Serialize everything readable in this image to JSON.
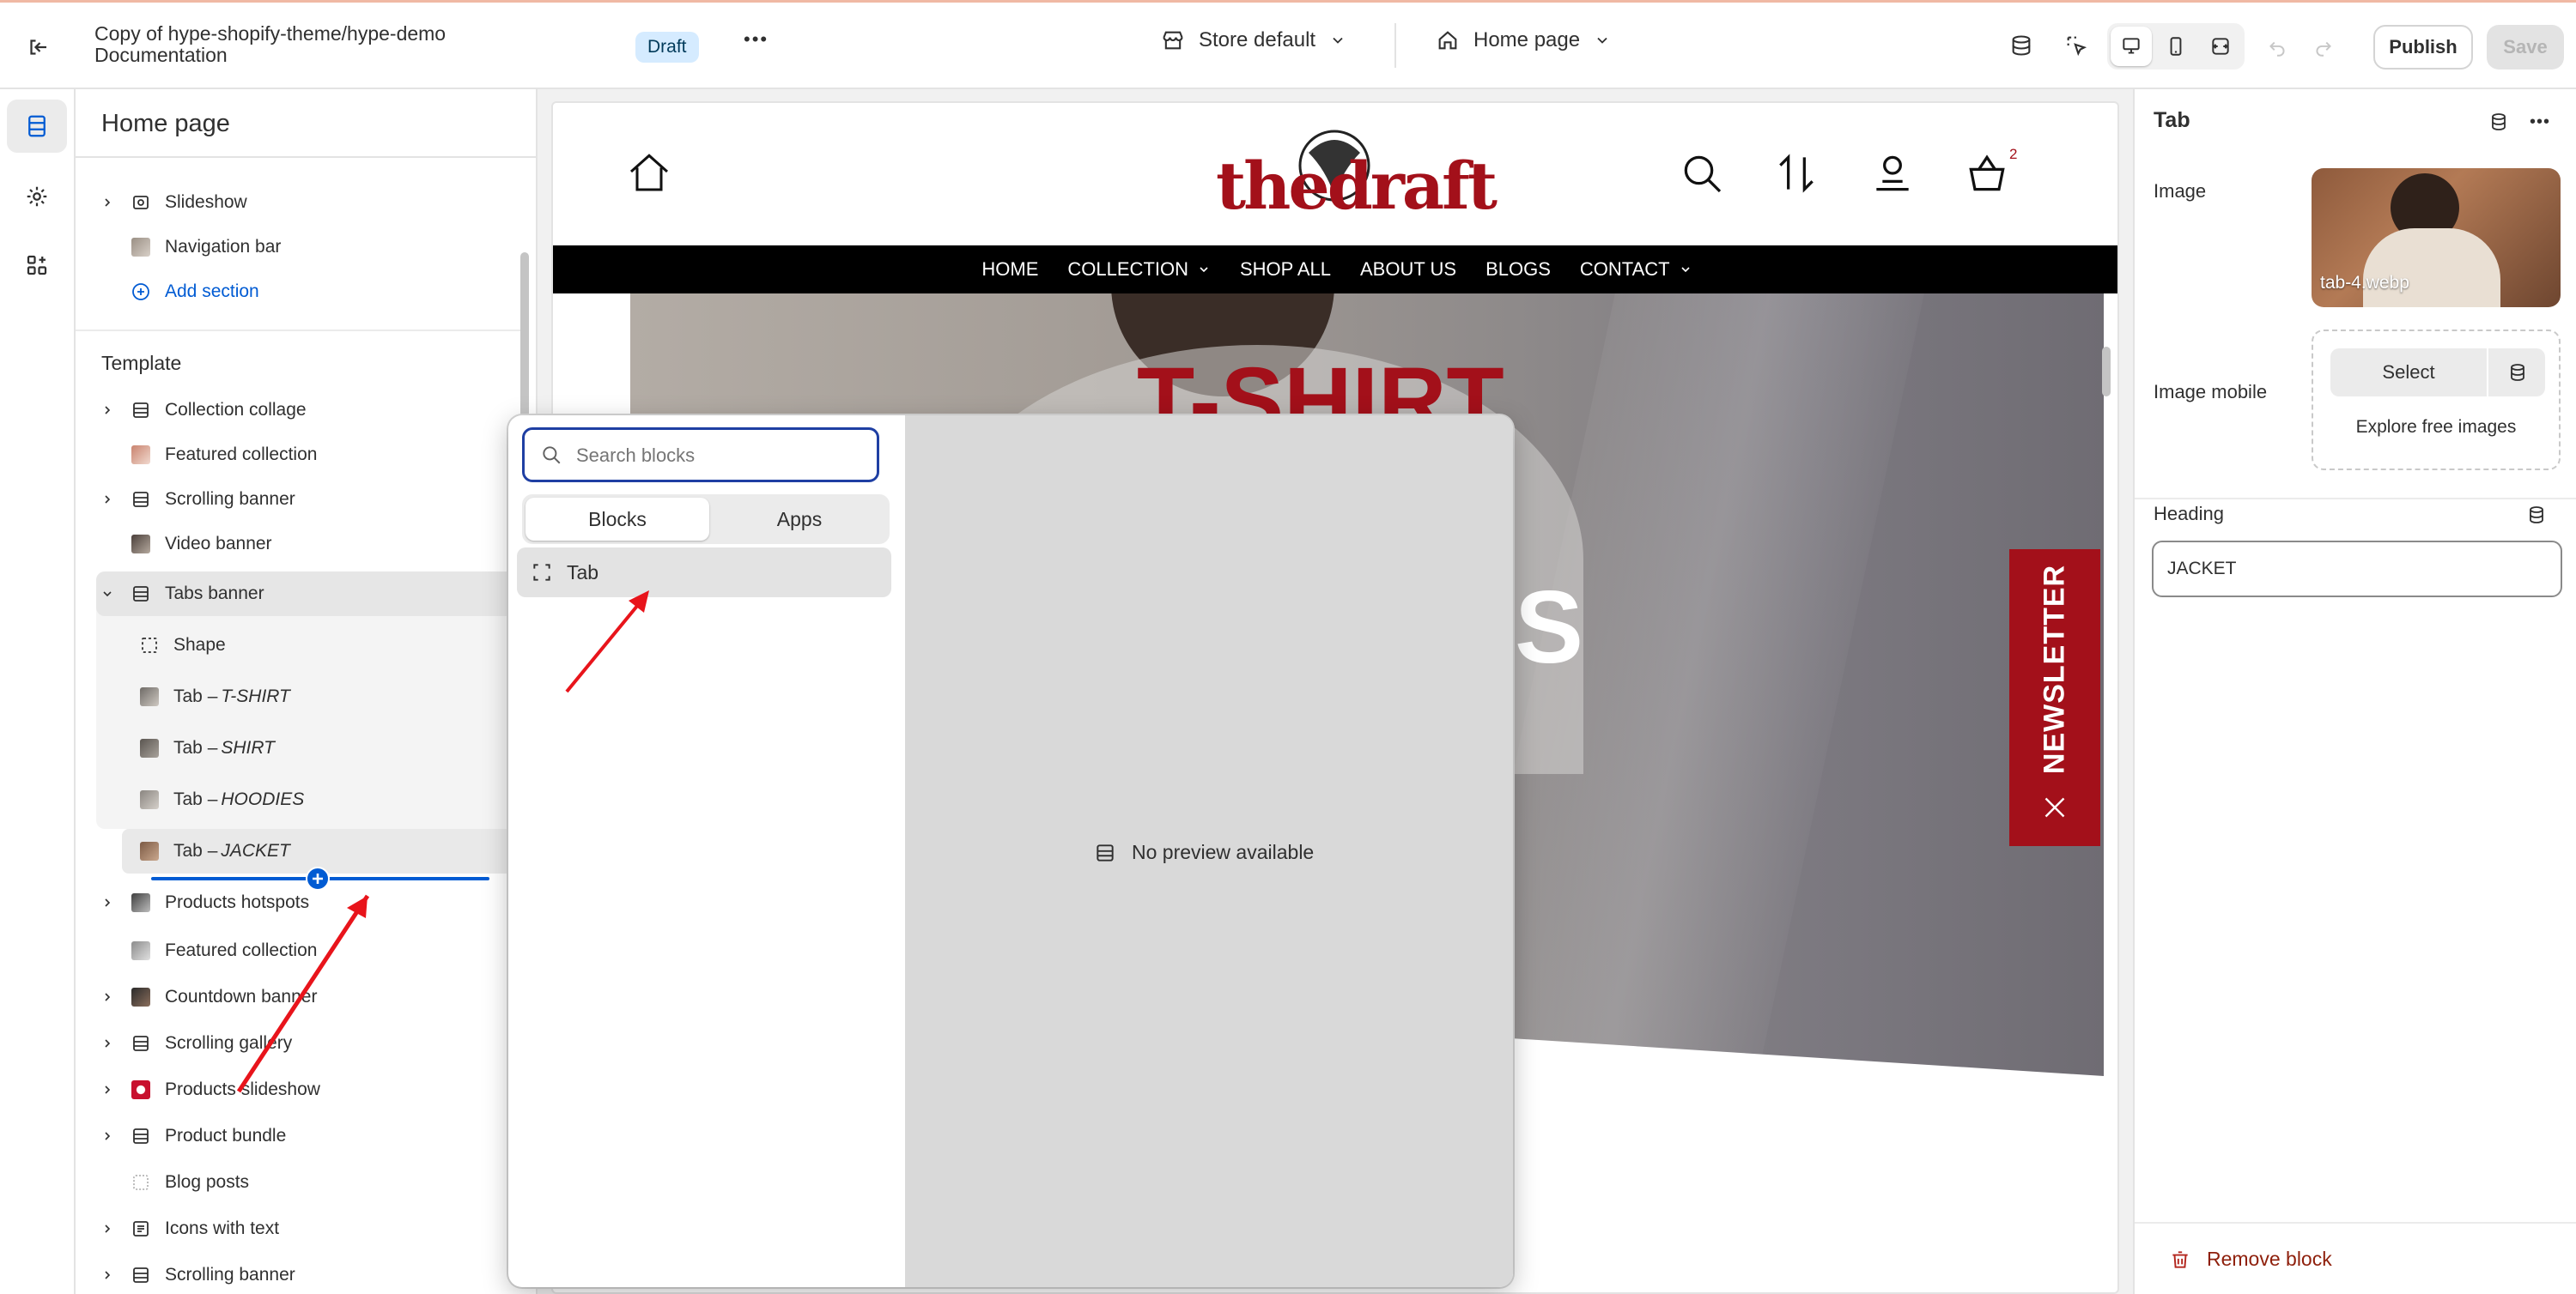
{
  "topbar": {
    "theme_title_line1": "Copy of hype-shopify-theme/hype-demo",
    "theme_title_line2": "Documentation",
    "draft_badge": "Draft",
    "more_label": "•••",
    "store_selector": "Store default",
    "page_selector": "Home page",
    "publish_label": "Publish",
    "save_label": "Save"
  },
  "sidebar": {
    "page_title": "Home page",
    "header_items": [
      {
        "label": "Slideshow"
      },
      {
        "label": "Navigation bar"
      }
    ],
    "add_section_label": "Add section",
    "template_label": "Template",
    "template_items": [
      {
        "label": "Collection collage"
      },
      {
        "label": "Featured collection"
      },
      {
        "label": "Scrolling banner"
      },
      {
        "label": "Video banner"
      },
      {
        "label": "Tabs banner"
      }
    ],
    "tabs_children": [
      {
        "prefix": "Shape",
        "name": ""
      },
      {
        "prefix": "Tab – ",
        "name": "T-SHIRT"
      },
      {
        "prefix": "Tab – ",
        "name": "SHIRT"
      },
      {
        "prefix": "Tab – ",
        "name": "HOODIES"
      },
      {
        "prefix": "Tab – ",
        "name": "JACKET"
      }
    ],
    "after_items": [
      {
        "label": "Products hotspots"
      },
      {
        "label": "Featured collection"
      },
      {
        "label": "Countdown banner"
      },
      {
        "label": "Scrolling gallery"
      },
      {
        "label": "Products slideshow"
      },
      {
        "label": "Product bundle"
      },
      {
        "label": "Blog posts"
      },
      {
        "label": "Icons with text"
      },
      {
        "label": "Scrolling banner"
      }
    ]
  },
  "preview": {
    "logo_text": "thedraft",
    "cart_count": "2",
    "nav": [
      "HOME",
      "COLLECTION",
      "SHOP ALL",
      "ABOUT US",
      "BLOGS",
      "CONTACT"
    ],
    "hero_title": "T-SHIRT",
    "hero_partial": "S",
    "newsletter_label": "NEWSLETTER"
  },
  "popover": {
    "search_placeholder": "Search blocks",
    "tab_blocks": "Blocks",
    "tab_apps": "Apps",
    "block_item": "Tab",
    "no_preview": "No preview available"
  },
  "inspector": {
    "title": "Tab",
    "image_label": "Image",
    "image_filename": "tab-4.webp",
    "image_mobile_label": "Image mobile",
    "select_label": "Select",
    "explore_label": "Explore free images",
    "heading_label": "Heading",
    "heading_value": "JACKET",
    "remove_label": "Remove block"
  },
  "colors": {
    "brand_red": "#a3101a",
    "focus_blue": "#005bd3",
    "danger": "#8e1f0b"
  }
}
